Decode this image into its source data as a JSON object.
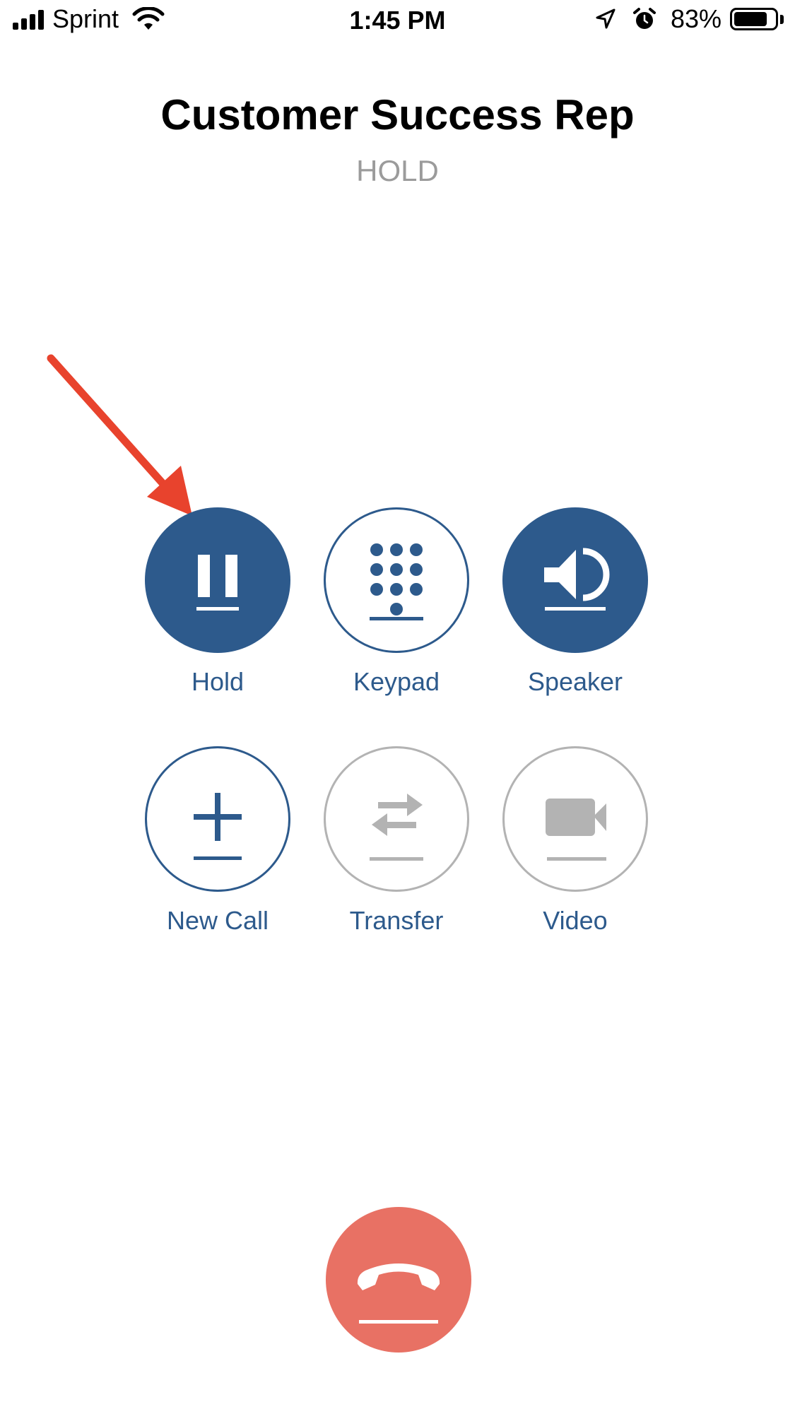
{
  "status_bar": {
    "carrier": "Sprint",
    "time": "1:45 PM",
    "battery_percent": "83%",
    "battery_level": 0.83,
    "icons": [
      "signal-icon",
      "wifi-icon",
      "location-icon",
      "alarm-icon",
      "battery-icon"
    ]
  },
  "call": {
    "name": "Customer Success Rep",
    "status": "HOLD"
  },
  "controls": [
    {
      "label": "Hold",
      "icon": "pause-icon",
      "state": "active"
    },
    {
      "label": "Keypad",
      "icon": "keypad-icon",
      "state": "enabled"
    },
    {
      "label": "Speaker",
      "icon": "speaker-icon",
      "state": "active"
    },
    {
      "label": "New Call",
      "icon": "plus-icon",
      "state": "enabled"
    },
    {
      "label": "Transfer",
      "icon": "transfer-icon",
      "state": "disabled"
    },
    {
      "label": "Video",
      "icon": "video-camera-icon",
      "state": "disabled"
    }
  ],
  "end_call": {
    "icon": "hang-up-icon"
  },
  "colors": {
    "accent": "#2d5a8c",
    "end_call": "#e87164",
    "disabled": "#b3b3b3",
    "status_text": "#9b9b9b",
    "annotation_arrow": "#e8432d"
  }
}
